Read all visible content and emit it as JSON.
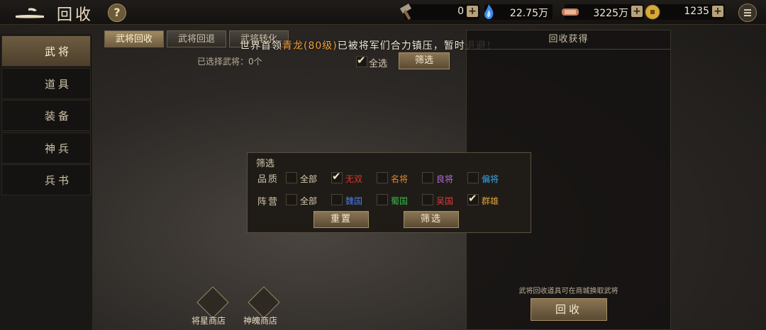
{
  "header": {
    "title": "回收",
    "help": "?",
    "resources": [
      {
        "name": "hammer-icon",
        "value": "0"
      },
      {
        "name": "soul-fire-icon",
        "value": "22.75万"
      },
      {
        "name": "scroll-icon",
        "value": "3225万"
      },
      {
        "name": "coin-icon",
        "value": "1235"
      }
    ]
  },
  "sidebar": {
    "items": [
      {
        "label": "武将"
      },
      {
        "label": "道具"
      },
      {
        "label": "装备"
      },
      {
        "label": "神兵"
      },
      {
        "label": "兵书"
      }
    ]
  },
  "tabs": [
    {
      "label": "武将回收"
    },
    {
      "label": "武将回退"
    },
    {
      "label": "武将转化"
    }
  ],
  "announcement": {
    "prefix": "世界首领",
    "highlight": "青龙(80级)",
    "suffix": "已被将军们合力镇压，暂时退避！"
  },
  "selection": {
    "count_text": "已选择武将：0个",
    "select_all": "全选",
    "filter_button": "筛选"
  },
  "filter": {
    "title": "筛选",
    "quality_label": "品质",
    "quality_options": [
      {
        "label": "全部",
        "checked": false,
        "color": "#d8cbb0"
      },
      {
        "label": "无双",
        "checked": true,
        "color": "#e0342a"
      },
      {
        "label": "名将",
        "checked": false,
        "color": "#e08a2a"
      },
      {
        "label": "良将",
        "checked": false,
        "color": "#b76ae0"
      },
      {
        "label": "偏将",
        "checked": false,
        "color": "#3aa8e8"
      }
    ],
    "faction_label": "阵营",
    "faction_options": [
      {
        "label": "全部",
        "checked": false,
        "color": "#d8cbb0"
      },
      {
        "label": "魏国",
        "checked": false,
        "color": "#4a7ae8"
      },
      {
        "label": "蜀国",
        "checked": false,
        "color": "#3ab84a"
      },
      {
        "label": "吴国",
        "checked": false,
        "color": "#e03a3a"
      },
      {
        "label": "群雄",
        "checked": true,
        "color": "#e0a23a"
      }
    ],
    "reset_button": "重置",
    "confirm_button": "筛选"
  },
  "right_panel": {
    "title": "回收获得",
    "note": "武将回收道具可在商城换取武将",
    "recycle_button": "回收"
  },
  "shops": [
    {
      "label": "将星商店"
    },
    {
      "label": "神魄商店"
    }
  ]
}
